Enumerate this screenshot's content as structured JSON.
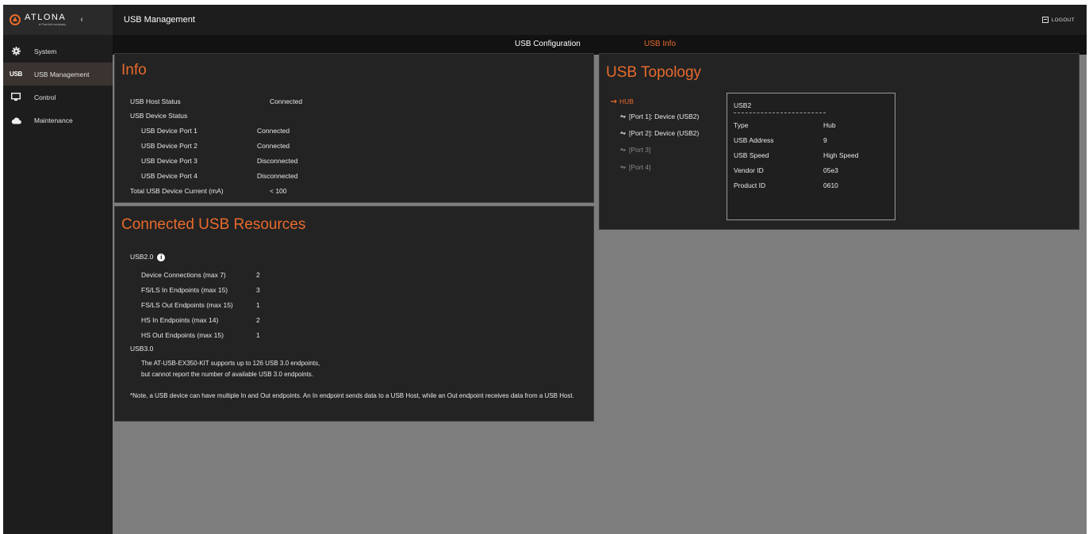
{
  "brand": {
    "logo_word": "ATLONA",
    "logo_sub": "a Panduit company",
    "collapse_glyph": "‹"
  },
  "sidebar": {
    "items": [
      {
        "label": "System",
        "icon": "gear-icon"
      },
      {
        "label": "USB Management",
        "icon": "usb-icon",
        "badge": "USB",
        "active": true
      },
      {
        "label": "Control",
        "icon": "monitor-icon"
      },
      {
        "label": "Maintenance",
        "icon": "cloud-icon"
      }
    ]
  },
  "header": {
    "title": "USB Management",
    "logout_label": "LOGOUT"
  },
  "tabs": {
    "config": "USB Configuration",
    "info": "USB Info",
    "active": "info"
  },
  "info": {
    "title": "Info",
    "rows": [
      {
        "label": "USB Host Status",
        "value": "Connected"
      },
      {
        "label": "USB Device Status",
        "value": ""
      },
      {
        "label": "USB Device Port 1",
        "value": "Connected"
      },
      {
        "label": "USB Device Port 2",
        "value": "Connected"
      },
      {
        "label": "USB Device Port 3",
        "value": "Disconnected"
      },
      {
        "label": "USB Device Port 4",
        "value": "Disconnected"
      },
      {
        "label": "Total USB Device Current (mA)",
        "value": "< 100"
      }
    ]
  },
  "resources": {
    "title": "Connected USB Resources",
    "usb2_label": "USB2.0",
    "info_glyph": "i",
    "usb2_rows": [
      {
        "label": "Device Connections (max 7)",
        "value": "2"
      },
      {
        "label": "FS/LS In Endpoints (max 15)",
        "value": "3"
      },
      {
        "label": "FS/LS Out Endpoints (max 15)",
        "value": "1"
      },
      {
        "label": "HS In Endpoints (max 14)",
        "value": "2"
      },
      {
        "label": "HS Out Endpoints (max 15)",
        "value": "1"
      }
    ],
    "usb3_label": "USB3.0",
    "usb3_line1": "The AT-USB-EX350-KIT supports up to 126 USB 3.0 endpoints,",
    "usb3_line2": "but cannot report the number of available USB 3.0 endpoints.",
    "note": "*Note, a USB device can have multiple In and Out endpoints. An In endpoint sends data to a USB Host, while an Out endpoint receives data from a USB Host."
  },
  "topology": {
    "title": "USB Topology",
    "hub_label": "HUB",
    "ports": [
      {
        "label": "[Port 1]: Device (USB2)",
        "connected": true
      },
      {
        "label": "[Port 2]: Device (USB2)",
        "connected": true
      },
      {
        "label": "[Port 3]",
        "connected": false
      },
      {
        "label": "[Port 4]",
        "connected": false
      }
    ],
    "detail": {
      "heading": "USB2",
      "rows": [
        {
          "label": "Type",
          "value": "Hub"
        },
        {
          "label": "USB Address",
          "value": "9"
        },
        {
          "label": "USB Speed",
          "value": "High Speed"
        },
        {
          "label": "Vendor ID",
          "value": "05e3"
        },
        {
          "label": "Product ID",
          "value": "0610"
        }
      ]
    }
  },
  "colors": {
    "accent": "#e86a2c",
    "panel": "#232323",
    "sidebar": "#1d1d1d",
    "workspace": "#7d7d7d"
  }
}
